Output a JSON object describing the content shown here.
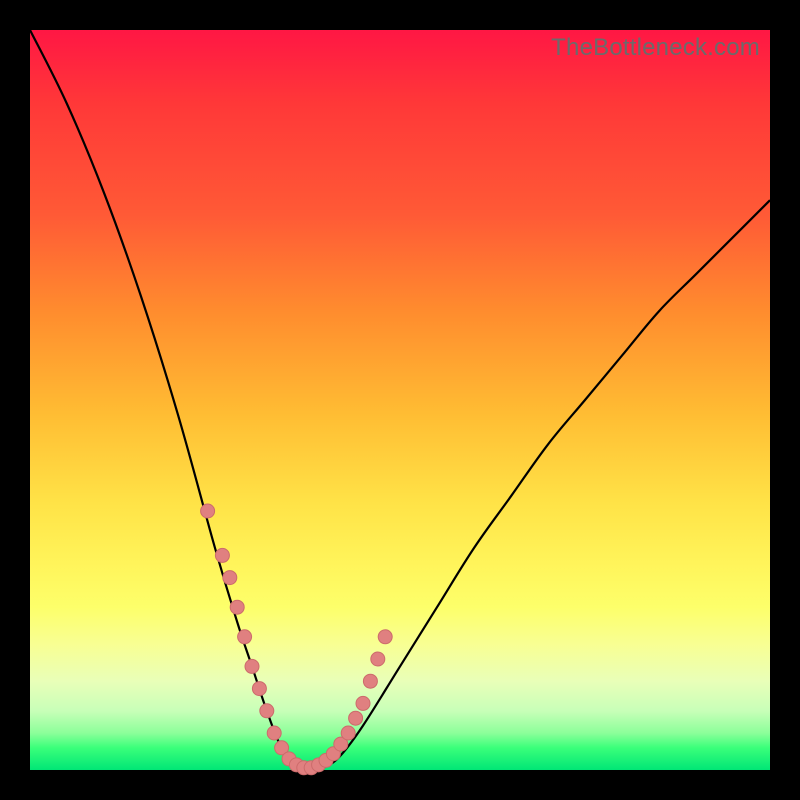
{
  "watermark": "TheBottleneck.com",
  "colors": {
    "frame": "#000000",
    "curve": "#000000",
    "marker_fill": "#e08080",
    "marker_stroke": "#cc6b6b",
    "gradient_top": "#ff1744",
    "gradient_bottom": "#00e676"
  },
  "chart_data": {
    "type": "line",
    "title": "",
    "xlabel": "",
    "ylabel": "",
    "xlim": [
      0,
      100
    ],
    "ylim": [
      0,
      100
    ],
    "notes": "Bottleneck-percentage style curve over a red→green vertical gradient. No numeric axes drawn. Minimum is ~0 near x≈35–40.",
    "series": [
      {
        "name": "curve",
        "x": [
          0,
          5,
          10,
          15,
          20,
          25,
          28,
          30,
          32,
          34,
          36,
          38,
          40,
          42,
          45,
          50,
          55,
          60,
          65,
          70,
          75,
          80,
          85,
          90,
          95,
          100
        ],
        "values": [
          100,
          90,
          78,
          64,
          48,
          30,
          20,
          14,
          8,
          3,
          1,
          0,
          0.5,
          2,
          6,
          14,
          22,
          30,
          37,
          44,
          50,
          56,
          62,
          67,
          72,
          77
        ]
      }
    ],
    "markers": {
      "name": "highlighted-points",
      "x": [
        24,
        26,
        27,
        28,
        29,
        30,
        31,
        32,
        33,
        34,
        35,
        36,
        37,
        38,
        39,
        40,
        41,
        42,
        43,
        44,
        45,
        46,
        47,
        48
      ],
      "values": [
        35,
        29,
        26,
        22,
        18,
        14,
        11,
        8,
        5,
        3,
        1.5,
        0.7,
        0.3,
        0.3,
        0.7,
        1.3,
        2.2,
        3.5,
        5,
        7,
        9,
        12,
        15,
        18
      ]
    }
  }
}
